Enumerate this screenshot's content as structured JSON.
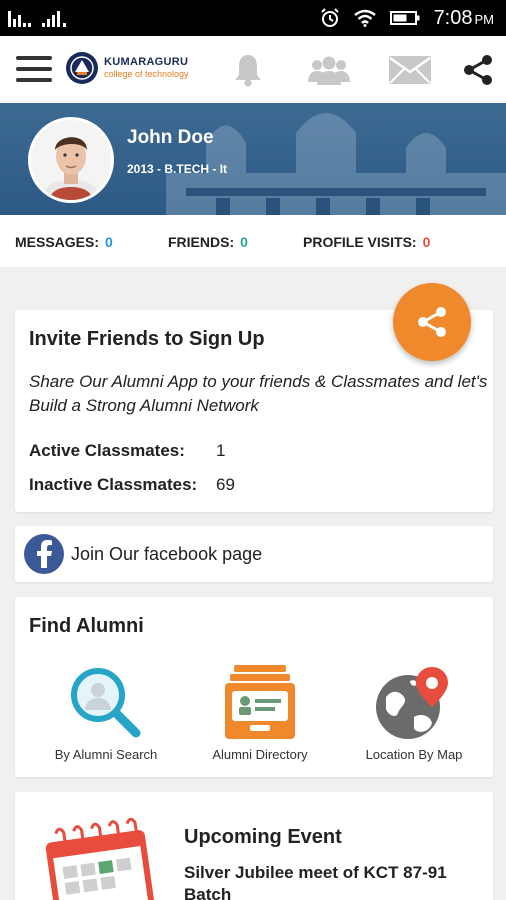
{
  "status_bar": {
    "time": "7:08",
    "ampm": "PM",
    "icons": [
      "sim-signal-icon",
      "signal-icon",
      "alarm-icon",
      "wifi-icon",
      "battery-icon"
    ]
  },
  "app_bar": {
    "logo_name": "KUMARAGURU",
    "logo_tagline": "college of technology",
    "icons": [
      "menu-icon",
      "bell-icon",
      "friends-icon",
      "mail-icon",
      "share-icon"
    ]
  },
  "profile": {
    "name": "John Doe",
    "subtitle": "2013 - B.TECH - It"
  },
  "stats": {
    "messages_label": "MESSAGES:",
    "messages_value": "0",
    "friends_label": "FRIENDS:",
    "friends_value": "0",
    "visits_label": "PROFILE VISITS:",
    "visits_value": "0",
    "colors": {
      "messages": "#2196f3",
      "friends": "#26a69a",
      "visits": "#e74c3c"
    }
  },
  "invite": {
    "title": "Invite Friends to Sign Up",
    "description": "Share Our Alumni App to your friends & Classmates and let's Build a Strong Alumni Network",
    "active_label": "Active Classmates:",
    "active_value": "1",
    "inactive_label": "Inactive Classmates:",
    "inactive_value": "69"
  },
  "facebook": {
    "label": "Join Our facebook page"
  },
  "find_alumni": {
    "title": "Find Alumni",
    "options": [
      {
        "label": "By Alumni Search",
        "icon": "search-icon"
      },
      {
        "label": "Alumni Directory",
        "icon": "directory-icon"
      },
      {
        "label": "Location By Map",
        "icon": "map-location-icon"
      }
    ]
  },
  "event": {
    "heading": "Upcoming Event",
    "title": "Silver Jubilee meet of KCT 87-91 Batch"
  },
  "colors": {
    "accent": "#f0892b",
    "banner": "#2d5a85",
    "facebook": "#3b5998"
  }
}
